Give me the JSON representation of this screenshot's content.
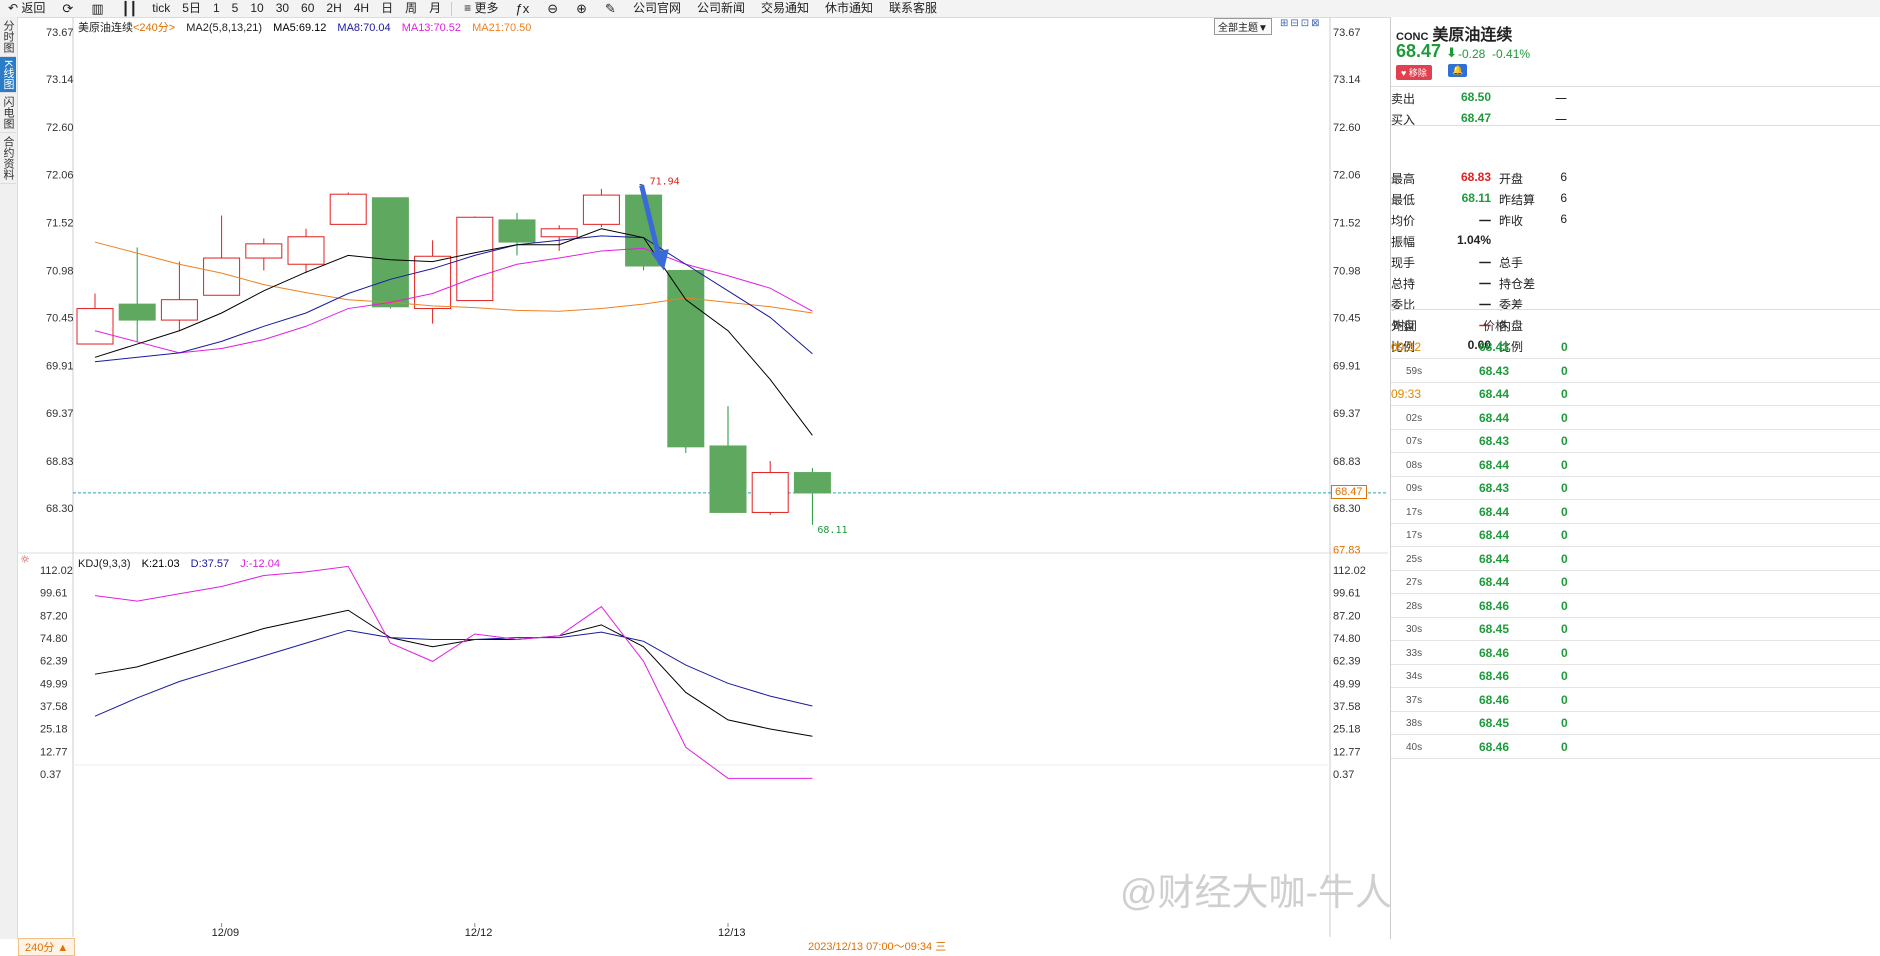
{
  "toolbar": {
    "back": "返回",
    "periods": [
      "tick",
      "5日",
      "1",
      "5",
      "10",
      "30",
      "60",
      "2H",
      "4H",
      "日",
      "周",
      "月"
    ],
    "more": "更多",
    "links": [
      "公司官网",
      "公司新闻",
      "交易通知",
      "休市通知",
      "联系客服"
    ]
  },
  "left_tabs": [
    "分时图",
    "K线图",
    "闪电图",
    "合约资料"
  ],
  "left_tab_active": "K线图",
  "legend": {
    "name": "美原油连续",
    "period": "<240分>",
    "ma_group": "MA2(5,8,13,21)",
    "ma5": "MA5:69.12",
    "ma8": "MA8:70.04",
    "ma13": "MA13:70.52",
    "ma21": "MA21:70.50"
  },
  "theme_button": "全部主题▼",
  "kdj_legend": {
    "name": "KDJ(9,3,3)",
    "k": "K:21.03",
    "d": "D:37.57",
    "j": "J:-12.04"
  },
  "period_button": "240分 ▲",
  "range_label": "2023/12/13 07:00～09:34 三",
  "watermark": "@财经大咖-牛人老陈",
  "current_price_label": "68.47",
  "colors": {
    "up": "#e02020",
    "down": "#1e9a3a",
    "ma5": "#000000",
    "ma8": "#1a1aa0",
    "ma13": "#e020e0",
    "ma21": "#f08020",
    "accent": "#e07000"
  },
  "chart_data": [
    {
      "type": "candlestick",
      "title": "美原油连续 240分",
      "y_ticks": [
        "73.67",
        "73.14",
        "72.60",
        "72.06",
        "71.52",
        "70.98",
        "70.45",
        "69.91",
        "69.37",
        "68.83",
        "68.30"
      ],
      "ylim": [
        68.17,
        73.67
      ],
      "extra_right_ticks": [
        "67.83"
      ],
      "x_labels": [
        "12/09",
        "12/12",
        "12/13"
      ],
      "candles": [
        {
          "o": 70.15,
          "h": 70.72,
          "l": 70.15,
          "c": 70.55
        },
        {
          "o": 70.6,
          "h": 71.24,
          "l": 70.18,
          "c": 70.42
        },
        {
          "o": 70.42,
          "h": 71.08,
          "l": 70.3,
          "c": 70.65
        },
        {
          "o": 70.7,
          "h": 71.6,
          "l": 70.7,
          "c": 71.12
        },
        {
          "o": 71.12,
          "h": 71.34,
          "l": 70.98,
          "c": 71.28
        },
        {
          "o": 71.05,
          "h": 71.45,
          "l": 70.95,
          "c": 71.36
        },
        {
          "o": 71.5,
          "h": 71.86,
          "l": 71.5,
          "c": 71.84
        },
        {
          "o": 71.8,
          "h": 71.8,
          "l": 70.55,
          "c": 70.57
        },
        {
          "o": 70.55,
          "h": 71.32,
          "l": 70.38,
          "c": 71.14
        },
        {
          "o": 70.64,
          "h": 71.59,
          "l": 70.64,
          "c": 71.58
        },
        {
          "o": 71.55,
          "h": 71.63,
          "l": 71.15,
          "c": 71.3
        },
        {
          "o": 71.36,
          "h": 71.49,
          "l": 71.2,
          "c": 71.45
        },
        {
          "o": 71.5,
          "h": 71.9,
          "l": 71.47,
          "c": 71.83
        },
        {
          "o": 71.83,
          "h": 71.94,
          "l": 70.98,
          "c": 71.03
        },
        {
          "o": 70.98,
          "h": 70.98,
          "l": 68.92,
          "c": 68.99
        },
        {
          "o": 69.0,
          "h": 69.45,
          "l": 68.25,
          "c": 68.25
        },
        {
          "o": 68.25,
          "h": 68.83,
          "l": 68.22,
          "c": 68.7
        },
        {
          "o": 68.7,
          "h": 68.75,
          "l": 68.11,
          "c": 68.47
        }
      ],
      "ma5": [
        70.0,
        null,
        70.3,
        70.5,
        70.75,
        70.96,
        71.15,
        71.1,
        71.08,
        71.18,
        71.27,
        71.27,
        71.45,
        71.35,
        70.65,
        70.3,
        69.75,
        69.12
      ],
      "ma8": [
        69.95,
        null,
        70.05,
        70.18,
        70.35,
        70.5,
        70.72,
        70.88,
        71.0,
        71.15,
        71.27,
        71.32,
        71.37,
        71.35,
        71.05,
        70.75,
        70.45,
        70.04
      ],
      "ma13": [
        70.3,
        null,
        70.05,
        70.1,
        70.2,
        70.35,
        70.55,
        70.62,
        70.72,
        70.9,
        71.05,
        71.12,
        71.2,
        71.23,
        71.05,
        70.92,
        70.78,
        70.52
      ],
      "ma21": [
        71.3,
        null,
        71.05,
        70.95,
        70.82,
        70.73,
        70.65,
        70.62,
        70.58,
        70.56,
        70.53,
        70.52,
        70.55,
        70.6,
        70.67,
        70.62,
        70.57,
        70.5
      ],
      "annotations": {
        "high": "71.94",
        "low": "68.11"
      }
    },
    {
      "type": "line",
      "title": "KDJ(9,3,3)",
      "y_ticks": [
        "112.02",
        "99.61",
        "87.20",
        "74.80",
        "62.39",
        "49.99",
        "37.58",
        "25.18",
        "12.77",
        "0.37"
      ],
      "ylim": [
        -5,
        112.02
      ],
      "series": [
        {
          "name": "K",
          "values": [
            55,
            59,
            66,
            73,
            80,
            85,
            90,
            75,
            70,
            74,
            74,
            76,
            82,
            70,
            45,
            30,
            25,
            21.03
          ]
        },
        {
          "name": "D",
          "values": [
            32,
            42,
            51,
            58,
            65,
            72,
            79,
            75,
            74,
            74,
            75,
            75,
            78,
            73,
            60,
            50,
            43,
            37.57
          ]
        },
        {
          "name": "J",
          "values": [
            98,
            95,
            99,
            103,
            109,
            111,
            114,
            72,
            62,
            77,
            74,
            76,
            92,
            62,
            15,
            -5,
            -11,
            -12.04
          ]
        }
      ]
    }
  ],
  "quote": {
    "code": "CONC",
    "name": "美原油连续",
    "price": "68.47",
    "arrow": "⬇",
    "change": "-0.28",
    "change_pct": "-0.41%",
    "remove_btn": "移除",
    "rows": [
      {
        "l": "卖出",
        "v": "68.50",
        "vc": "green",
        "l2": "",
        "v2": "一"
      },
      {
        "l": "买入",
        "v": "68.47",
        "vc": "green",
        "l2": "",
        "v2": "一"
      },
      {
        "l": "最高",
        "v": "68.83",
        "vc": "red",
        "l2": "开盘",
        "v2": "6"
      },
      {
        "l": "最低",
        "v": "68.11",
        "vc": "green",
        "l2": "昨结算",
        "v2": "6"
      },
      {
        "l": "均价",
        "v": "一",
        "vc": "",
        "l2": "昨收",
        "v2": "6"
      },
      {
        "l": "振幅",
        "v": "1.04%",
        "vc": "",
        "l2": "",
        "v2": ""
      },
      {
        "l": "现手",
        "v": "一",
        "vc": "",
        "l2": "总手",
        "v2": ""
      },
      {
        "l": "总持",
        "v": "一",
        "vc": "",
        "l2": "持仓差",
        "v2": ""
      },
      {
        "l": "委比",
        "v": "一",
        "vc": "",
        "l2": "委差",
        "v2": ""
      },
      {
        "l": "外盘",
        "v": "一",
        "vc": "red",
        "l2": "内盘",
        "v2": ""
      },
      {
        "l": "比例",
        "v": "0.00",
        "vc": "",
        "l2": "比例",
        "v2": ""
      }
    ],
    "ticks_header": {
      "time": "时间",
      "price": "价格"
    },
    "ticks": [
      {
        "t": "09:32",
        "sec": false,
        "p": "68.43"
      },
      {
        "t": "59s",
        "sec": true,
        "p": "68.43"
      },
      {
        "t": "09:33",
        "sec": false,
        "p": "68.44"
      },
      {
        "t": "02s",
        "sec": true,
        "p": "68.44"
      },
      {
        "t": "07s",
        "sec": true,
        "p": "68.43"
      },
      {
        "t": "08s",
        "sec": true,
        "p": "68.44"
      },
      {
        "t": "09s",
        "sec": true,
        "p": "68.43"
      },
      {
        "t": "17s",
        "sec": true,
        "p": "68.44"
      },
      {
        "t": "17s",
        "sec": true,
        "p": "68.44"
      },
      {
        "t": "25s",
        "sec": true,
        "p": "68.44"
      },
      {
        "t": "27s",
        "sec": true,
        "p": "68.44"
      },
      {
        "t": "28s",
        "sec": true,
        "p": "68.46"
      },
      {
        "t": "30s",
        "sec": true,
        "p": "68.45"
      },
      {
        "t": "33s",
        "sec": true,
        "p": "68.46"
      },
      {
        "t": "34s",
        "sec": true,
        "p": "68.46"
      },
      {
        "t": "37s",
        "sec": true,
        "p": "68.46"
      },
      {
        "t": "38s",
        "sec": true,
        "p": "68.45"
      },
      {
        "t": "40s",
        "sec": true,
        "p": "68.46"
      }
    ],
    "tick_suffix": "0"
  }
}
